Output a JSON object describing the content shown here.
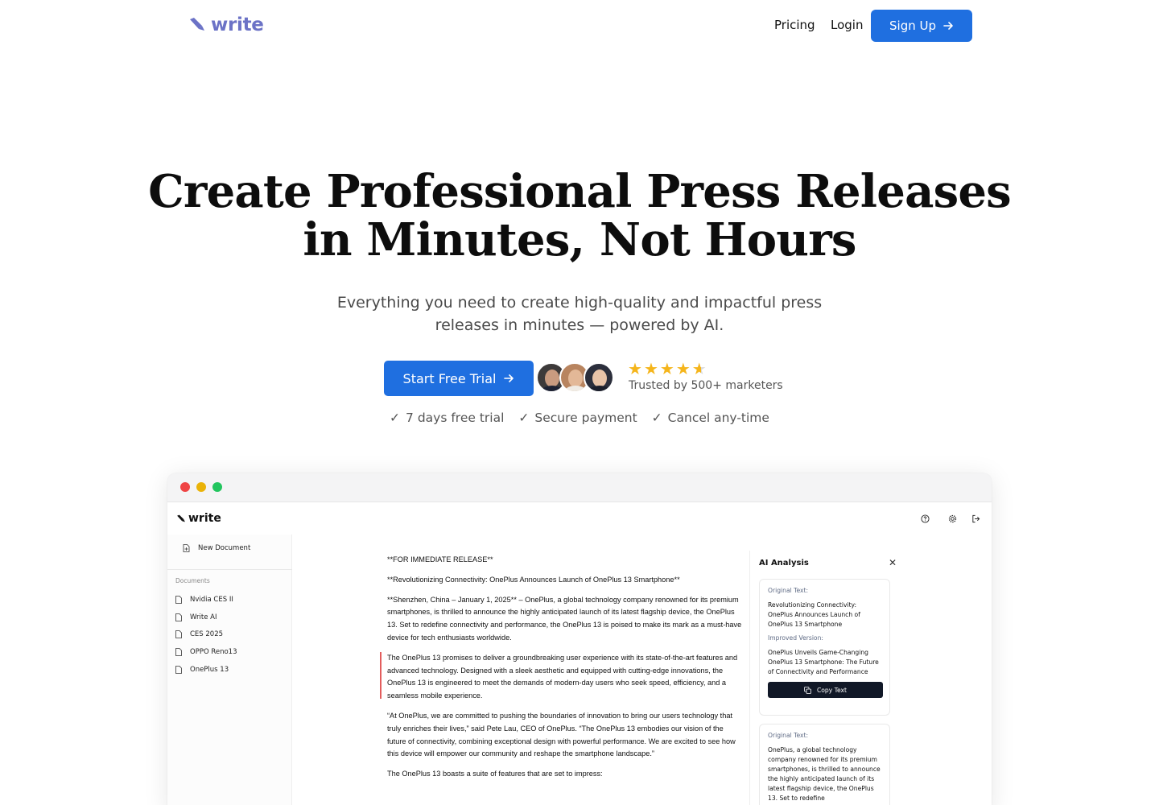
{
  "nav": {
    "logo_text": "write",
    "pricing": "Pricing",
    "login": "Login",
    "signup": "Sign Up"
  },
  "hero": {
    "title_line1": "Create Professional Press Releases",
    "title_line2": "in Minutes, Not Hours",
    "subtitle": "Everything you need to create high-quality and impactful press releases in minutes — powered by AI.",
    "cta": "Start Free Trial",
    "rating_stars": 4.5,
    "trusted": "Trusted by 500+ marketers",
    "checks": [
      "7 days free trial",
      "Secure payment",
      "Cancel any-time"
    ]
  },
  "app": {
    "logo_text": "write",
    "new_document": "New Document",
    "documents_heading": "Documents",
    "documents": [
      "Nvidia CES II",
      "Write AI",
      "CES 2025",
      "OPPO Reno13",
      "OnePlus 13"
    ],
    "doc_paragraphs": [
      "**FOR IMMEDIATE RELEASE**",
      "**Revolutionizing Connectivity: OnePlus Announces Launch of OnePlus 13 Smartphone**",
      "**Shenzhen, China – January 1, 2025** – OnePlus, a global technology company renowned for its premium smartphones, is thrilled to announce the highly anticipated launch of its latest flagship device, the OnePlus 13. Set to redefine connectivity and performance, the OnePlus 13 is poised to make its mark as a must-have device for tech enthusiasts worldwide.",
      "The OnePlus 13 promises to deliver a groundbreaking user experience with its state-of-the-art features and advanced technology. Designed with a sleek aesthetic and equipped with cutting-edge innovations, the OnePlus 13 is engineered to meet the demands of modern-day users who seek speed, efficiency, and a seamless mobile experience.",
      "“At OnePlus, we are committed to pushing the boundaries of innovation to bring our users technology that truly enriches their lives,” said Pete Lau, CEO of OnePlus. “The OnePlus 13 embodies our vision of the future of connectivity, combining exceptional design with powerful performance. We are excited to see how this device will empower our community and reshape the smartphone landscape.”",
      "The OnePlus 13 boasts a suite of features that are set to impress:"
    ],
    "analysis": {
      "title": "AI Analysis",
      "original_label": "Original Text:",
      "improved_label": "Improved Version:",
      "card1_original": "Revolutionizing Connectivity: OnePlus Announces Launch of OnePlus 13 Smartphone",
      "card1_improved": "OnePlus Unveils Game-Changing OnePlus 13 Smartphone: The Future of Connectivity and Performance",
      "copy": "Copy Text",
      "card2_original": "OnePlus, a global technology company renowned for its premium smartphones, is thrilled to announce the highly anticipated launch of its latest flagship device, the OnePlus 13. Set to redefine"
    }
  },
  "colors": {
    "brand": "#6b72c6",
    "primary_button": "#1f6fe0",
    "star": "#f5b51b",
    "dark_button": "#111827"
  }
}
